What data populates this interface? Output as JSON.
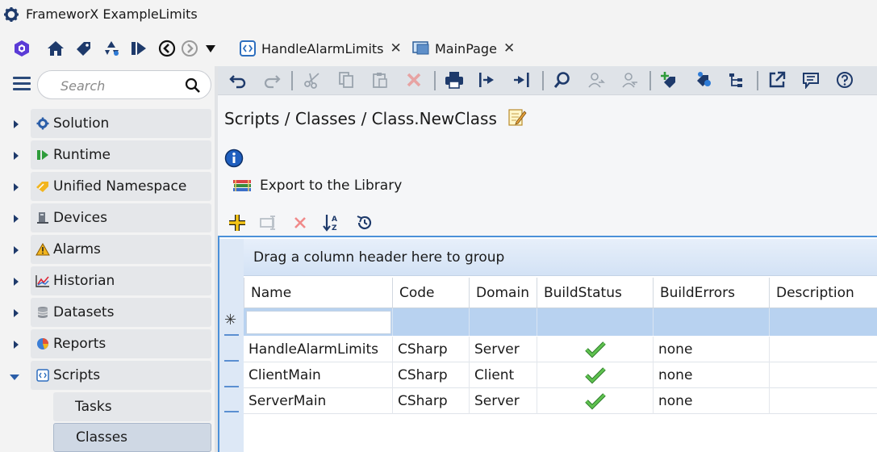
{
  "window": {
    "title": "FrameworX ExampleLimits"
  },
  "top_toolbar": {
    "icons": [
      "cube-logo-icon",
      "home-icon",
      "tag-icon",
      "recycle-icon",
      "run-icon",
      "back-icon",
      "forward-icon",
      "dropdown-icon"
    ]
  },
  "tabs": [
    {
      "label": "HandleAlarmLimits",
      "icon": "script-icon"
    },
    {
      "label": "MainPage",
      "icon": "display-icon"
    }
  ],
  "sidebar": {
    "search_placeholder": "Search",
    "items": [
      {
        "label": "Solution",
        "icon": "gear-icon",
        "expanded": false
      },
      {
        "label": "Runtime",
        "icon": "runtime-icon",
        "expanded": false
      },
      {
        "label": "Unified Namespace",
        "icon": "namespace-icon",
        "expanded": false
      },
      {
        "label": "Devices",
        "icon": "devices-icon",
        "expanded": false
      },
      {
        "label": "Alarms",
        "icon": "warning-icon",
        "expanded": false
      },
      {
        "label": "Historian",
        "icon": "chart-icon",
        "expanded": false
      },
      {
        "label": "Datasets",
        "icon": "database-icon",
        "expanded": false
      },
      {
        "label": "Reports",
        "icon": "pie-icon",
        "expanded": false
      },
      {
        "label": "Scripts",
        "icon": "script-icon",
        "expanded": true
      }
    ],
    "sub_items": [
      {
        "label": "Tasks",
        "active": false
      },
      {
        "label": "Classes",
        "active": true
      }
    ]
  },
  "main": {
    "breadcrumb": "Scripts / Classes / Class.NewClass",
    "export_label": "Export to the Library",
    "group_panel_text": "Drag a column header here to group",
    "new_row_marker": "✳",
    "columns": [
      "Name",
      "Code",
      "Domain",
      "BuildStatus",
      "BuildErrors",
      "Description"
    ],
    "rows": [
      {
        "Name": "HandleAlarmLimits",
        "Code": "CSharp",
        "Domain": "Server",
        "BuildStatus": "ok",
        "BuildErrors": "none",
        "Description": ""
      },
      {
        "Name": "ClientMain",
        "Code": "CSharp",
        "Domain": "Client",
        "BuildStatus": "ok",
        "BuildErrors": "none",
        "Description": ""
      },
      {
        "Name": "ServerMain",
        "Code": "CSharp",
        "Domain": "Server",
        "BuildStatus": "ok",
        "BuildErrors": "none",
        "Description": ""
      }
    ]
  },
  "colors": {
    "accent": "#4a90d9",
    "brand": "#2b4a7a",
    "success": "#3aa335",
    "danger": "#e04848"
  }
}
